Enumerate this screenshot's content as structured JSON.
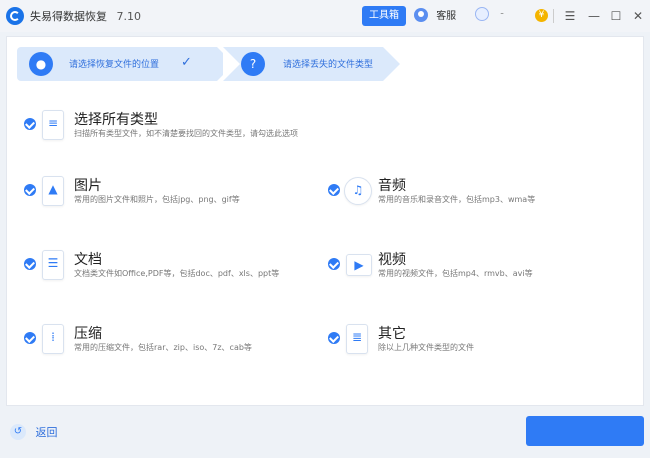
{
  "app": {
    "title": "失易得数据恢复",
    "version": "7.10",
    "toolbox": "工具箱",
    "service": "客服",
    "qq": "-",
    "coin": "¥"
  },
  "window": {
    "menu": "☰",
    "minimize": "—",
    "maximize": "☐",
    "close": "✕"
  },
  "steps": [
    {
      "label": "请选择恢复文件的位置",
      "icon": "location-pin-icon",
      "done": true
    },
    {
      "label": "请选择丢失的文件类型",
      "icon": "question-doc-icon",
      "done": false
    }
  ],
  "step_check": "✓",
  "types": [
    {
      "key": "all",
      "title": "选择所有类型",
      "desc": "扫描所有类型文件，如不清楚要找回的文件类型，请勾选此选项",
      "icon": "list-icon",
      "glyph": "≡",
      "checked": true
    },
    {
      "key": "image",
      "title": "图片",
      "desc": "常用的图片文件和照片，包括jpg、png、gif等",
      "icon": "image-icon",
      "glyph": "▲",
      "checked": true
    },
    {
      "key": "audio",
      "title": "音频",
      "desc": "常用的音乐和录音文件，包括mp3、wma等",
      "icon": "music-icon",
      "glyph": "♫",
      "checked": true
    },
    {
      "key": "doc",
      "title": "文档",
      "desc": "文档类文件如Office,PDF等，包括doc、pdf、xls、ppt等",
      "icon": "document-icon",
      "glyph": "☰",
      "checked": true
    },
    {
      "key": "video",
      "title": "视频",
      "desc": "常用的视频文件，包括mp4、rmvb、avi等",
      "icon": "play-icon",
      "glyph": "▶",
      "checked": true
    },
    {
      "key": "archive",
      "title": "压缩",
      "desc": "常用的压缩文件，包括rar、zip、iso、7z、cab等",
      "icon": "zip-icon",
      "glyph": "⁞",
      "checked": true
    },
    {
      "key": "other",
      "title": "其它",
      "desc": "除以上几种文件类型的文件",
      "icon": "other-files-icon",
      "glyph": "≣",
      "checked": true
    }
  ],
  "footer": {
    "back": "返回",
    "back_glyph": "↺"
  }
}
